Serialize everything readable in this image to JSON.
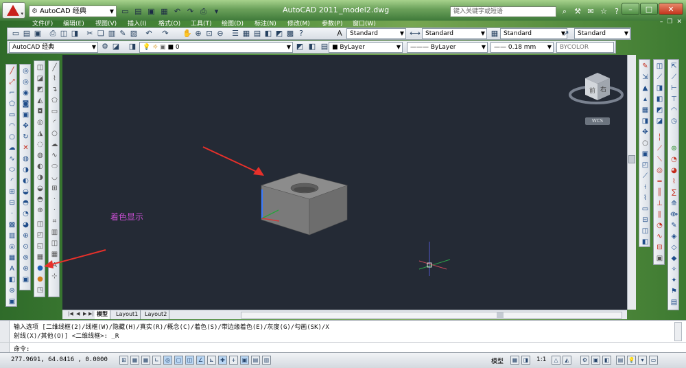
{
  "titlebar": {
    "workspace": "AutoCAD 经典",
    "app_name": "AutoCAD 2011",
    "file_name": "_model2.dwg",
    "search_placeholder": "键入关键字或短语"
  },
  "menu": [
    "文件(F)",
    "编辑(E)",
    "视图(V)",
    "插入(I)",
    "格式(O)",
    "工具(T)",
    "绘图(D)",
    "标注(N)",
    "修改(M)",
    "参数(P)",
    "窗口(W)"
  ],
  "styles": {
    "text_style": "Standard",
    "dim_style": "Standard",
    "table_style": "Standard",
    "multileader_style": "Standard"
  },
  "layers": {
    "workspace": "AutoCAD 经典",
    "current_layer": "0",
    "color": "ByLayer",
    "linetype": "ByLayer",
    "lineweight": "0.18 mm",
    "plotstyle": "BYCOLOR"
  },
  "viewcube": {
    "top_label": "前",
    "right_label": "右",
    "wcs": "WCS"
  },
  "canvas": {
    "annotation": "着色显示"
  },
  "tabs": {
    "model": "模型",
    "layout1": "Layout1",
    "layout2": "Layout2"
  },
  "command": {
    "line1": "输入选项 [二维线框(2)/线框(W)/隐藏(H)/真实(R)/概念(C)/着色(S)/带边缘着色(E)/灰度(G)/勾画(SK)/X",
    "line2": "射线(X)/其他(O)] <二维线框>: _R",
    "prompt": "命令:"
  },
  "status": {
    "coords": "277.9691,  64.0416 , 0.0000",
    "model": "模型",
    "scale": "1:1"
  },
  "colors": {
    "canvas": "#242a35",
    "solid_top": "#8c8c8c",
    "solid_front": "#7a7a7a",
    "solid_side": "#6d6d6d",
    "arrow": "#e8302a",
    "annotation": "#c94fd3"
  }
}
